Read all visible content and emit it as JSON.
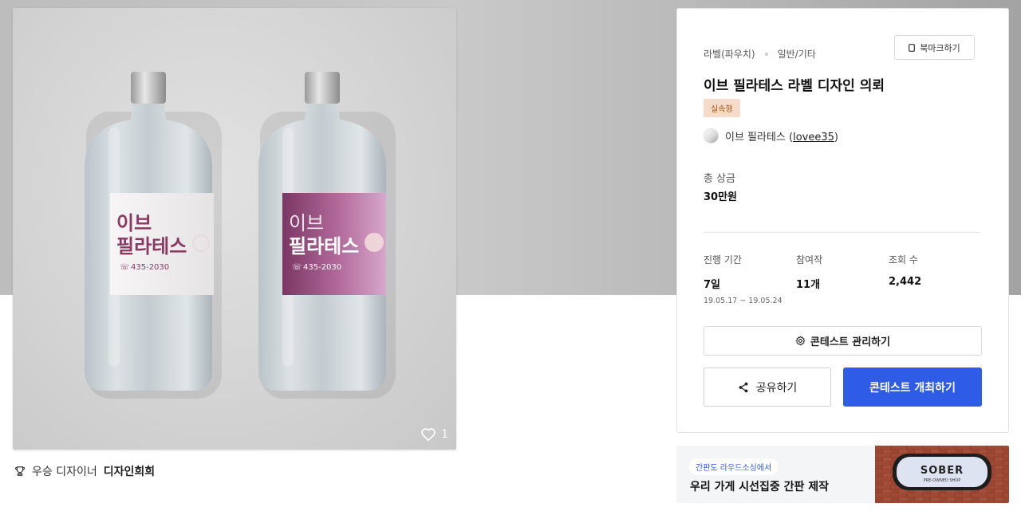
{
  "image": {
    "bottles": [
      {
        "name_line1": "이브",
        "name_line2": "필라테스",
        "phone": "435-2030",
        "label_color": "#f1efef",
        "text_color": "#8a3a62"
      },
      {
        "name_line1": "이브",
        "name_line2": "필라테스",
        "phone": "435-2030",
        "label_color": "#a85a8a",
        "text_color": "#ffffff"
      }
    ],
    "like_count": "1"
  },
  "award": {
    "prefix": "우승 디자이너",
    "designer": "디자인희희"
  },
  "panel": {
    "category": "라벨(파우치)",
    "subcategory": "일반/기타",
    "bookmark_label": "북마크하기",
    "title": "이브 필라테스 라벨 디자인 의뢰",
    "badge": "실속형",
    "host_name": "이브 필라테스 (",
    "host_id": "lovee35",
    "host_close": ")",
    "prize_label": "총 상금",
    "prize_value": "30만원",
    "stats": {
      "period_label": "진행 기간",
      "period_value": "7일",
      "period_dates": "19.05.17 ~ 19.05.24",
      "entries_label": "참여작",
      "entries_value": "11개",
      "views_label": "조회 수",
      "views_value": "2,442"
    },
    "manage_label": "콘테스트 관리하기",
    "share_label": "공유하기",
    "open_label": "콘테스트 개최하기"
  },
  "ad": {
    "chip": "간판도 라우드소싱에서",
    "text": "우리 가게 시선집중 간판 제작",
    "sign_main": "SOBER",
    "sign_sub": "PRE-OWNED SHOP"
  },
  "colors": {
    "accent": "#2e5ce6",
    "badge_bg": "#f6dcc8",
    "badge_text": "#a3581e"
  }
}
